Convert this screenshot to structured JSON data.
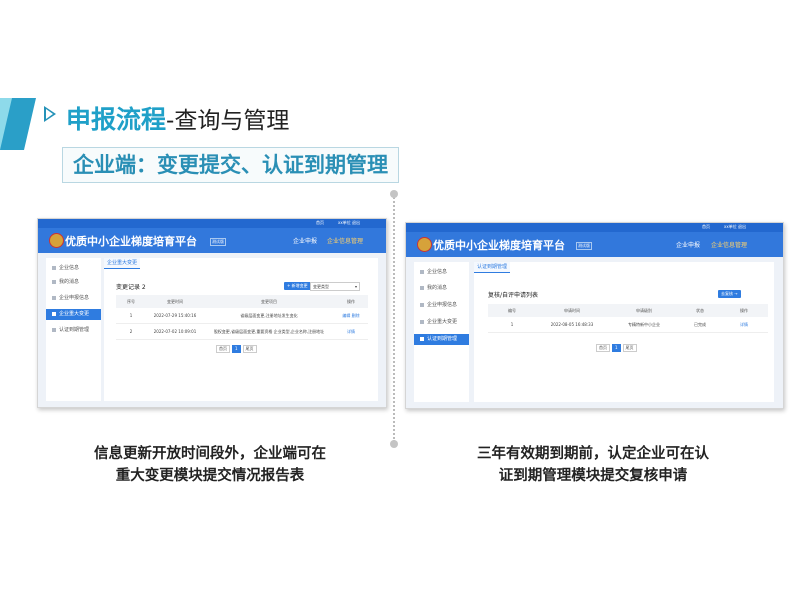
{
  "slide": {
    "title": "申报流程",
    "title_suffix": "-查询与管理",
    "subtitle": "企业端：变更提交、认证到期管理"
  },
  "left_screen": {
    "topbar": {
      "home": "首页",
      "user": "xx单位 退出"
    },
    "header": {
      "platform_name": "优质中小企业梯度培育平台",
      "badge": "测试版",
      "nav": [
        "企业申报",
        "企业信息管理"
      ],
      "active_nav": 1
    },
    "sidebar": {
      "items": [
        "企业信息",
        "我的消息",
        "企业申报信息",
        "企业重大变更",
        "认证到期管理"
      ],
      "active": 3
    },
    "tab": "企业重大变更",
    "card_title": "变更记录 2",
    "add_button": "+ 新增变更",
    "select_value": "变更类型",
    "table": {
      "columns": [
        "序号",
        "变更时间",
        "变更项目",
        "操作"
      ],
      "rows": [
        {
          "no": "1",
          "time": "2022-07-29 15:40:16",
          "item": "省级层面变更,注册地址发生变化",
          "ops": [
            "编辑",
            "删除"
          ]
        },
        {
          "no": "2",
          "time": "2022-07-02 10:09:01",
          "item": "股权变更,省级层面变更,重要资格 企业类型,企业名称,注册地址",
          "ops": [
            "详情"
          ]
        }
      ]
    },
    "pager": {
      "prev": "首页",
      "current": "1",
      "next": "尾页"
    }
  },
  "right_screen": {
    "topbar": {
      "home": "首页",
      "user": "xx单位 退出"
    },
    "header": {
      "platform_name": "优质中小企业梯度培育平台",
      "badge": "测试版",
      "nav": [
        "企业申报",
        "企业信息管理"
      ],
      "active_nav": 1
    },
    "sidebar": {
      "items": [
        "企业信息",
        "我的消息",
        "企业申报信息",
        "企业重大变更",
        "认证到期管理"
      ],
      "active": 4
    },
    "tab": "认证到期管理",
    "card_title": "复核/自评申请列表",
    "add_button": "去复核 →",
    "table": {
      "columns": [
        "编号",
        "申请时间",
        "申请级别",
        "状态",
        "操作"
      ],
      "rows": [
        {
          "no": "1",
          "time": "2022-08-05 16:48:33",
          "level": "专精特新中小企业",
          "status": "已完成",
          "ops": [
            "详情"
          ]
        }
      ]
    },
    "pager": {
      "prev": "首页",
      "current": "1",
      "next": "尾页"
    }
  },
  "captions": {
    "left": [
      "信息更新开放时间段外，企业端可在",
      "重大变更模块提交情况报告表"
    ],
    "right": [
      "三年有效期到期前，认定企业可在认",
      "证到期管理模块提交复核申请"
    ]
  }
}
